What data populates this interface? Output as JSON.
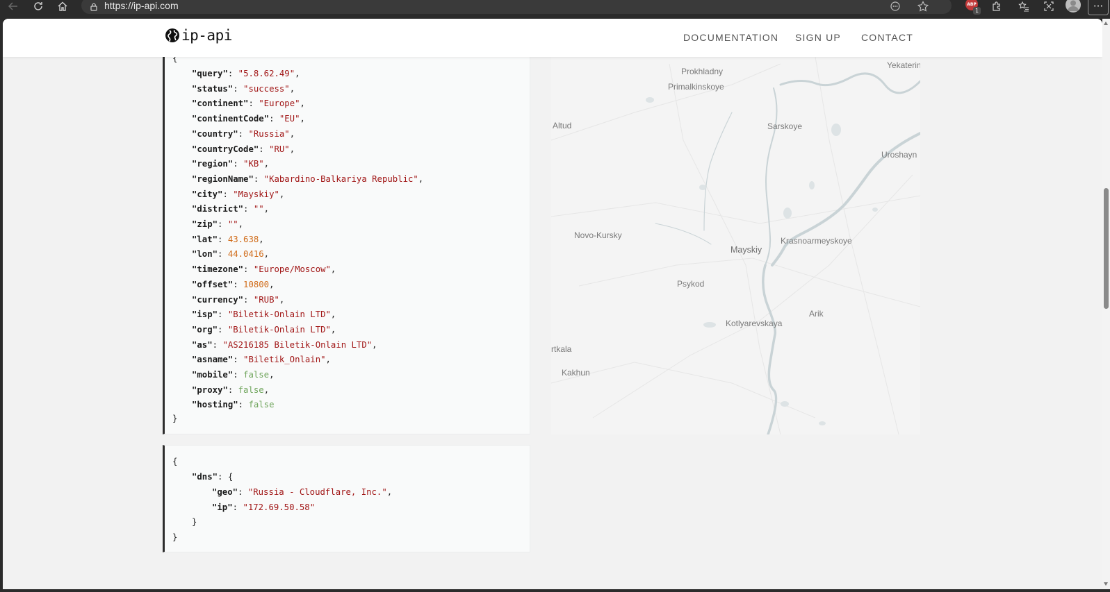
{
  "browser": {
    "url": "https://ip-api.com",
    "extension_badge_text": "ABP",
    "extension_badge_count": "1",
    "menu_label": "···"
  },
  "navbar": {
    "logo_text": "ip-api",
    "links": [
      "DOCUMENTATION",
      "SIGN UP",
      "CONTACT"
    ]
  },
  "response": [
    {
      "key": "query",
      "value": "5.8.62.49",
      "type": "string"
    },
    {
      "key": "status",
      "value": "success",
      "type": "string"
    },
    {
      "key": "continent",
      "value": "Europe",
      "type": "string"
    },
    {
      "key": "continentCode",
      "value": "EU",
      "type": "string"
    },
    {
      "key": "country",
      "value": "Russia",
      "type": "string"
    },
    {
      "key": "countryCode",
      "value": "RU",
      "type": "string"
    },
    {
      "key": "region",
      "value": "KB",
      "type": "string"
    },
    {
      "key": "regionName",
      "value": "Kabardino-Balkariya Republic",
      "type": "string"
    },
    {
      "key": "city",
      "value": "Mayskiy",
      "type": "string"
    },
    {
      "key": "district",
      "value": "",
      "type": "string"
    },
    {
      "key": "zip",
      "value": "",
      "type": "string"
    },
    {
      "key": "lat",
      "value": "43.638",
      "type": "number"
    },
    {
      "key": "lon",
      "value": "44.0416",
      "type": "number"
    },
    {
      "key": "timezone",
      "value": "Europe/Moscow",
      "type": "string"
    },
    {
      "key": "offset",
      "value": "10800",
      "type": "number"
    },
    {
      "key": "currency",
      "value": "RUB",
      "type": "string"
    },
    {
      "key": "isp",
      "value": "Biletik-Onlain LTD",
      "type": "string"
    },
    {
      "key": "org",
      "value": "Biletik-Onlain LTD",
      "type": "string"
    },
    {
      "key": "as",
      "value": "AS216185 Biletik-Onlain LTD",
      "type": "string"
    },
    {
      "key": "asname",
      "value": "Biletik_Onlain",
      "type": "string"
    },
    {
      "key": "mobile",
      "value": "false",
      "type": "boolean"
    },
    {
      "key": "proxy",
      "value": "false",
      "type": "boolean"
    },
    {
      "key": "hosting",
      "value": "false",
      "type": "boolean"
    }
  ],
  "dns": {
    "key": "dns",
    "fields": [
      {
        "key": "geo",
        "value": "Russia - Cloudflare, Inc.",
        "type": "string"
      },
      {
        "key": "ip",
        "value": "172.69.50.58",
        "type": "string"
      }
    ]
  },
  "map": {
    "labels": [
      "Prokhladny",
      "Primalkinskoye",
      "Yekaterin",
      "Altud",
      "Sarskoye",
      "Uroshayn",
      "Novo-Kursky",
      "Mayskiy",
      "Krasnoarmeyskoye",
      "Psykod",
      "Arik",
      "Kotlyarevskaya",
      "rtkala",
      "Kakhun"
    ]
  },
  "colors": {
    "json_key": "#1a1a1a",
    "json_string": "#a11616",
    "json_number": "#d06a17",
    "json_boolean": "#6ea45a",
    "panel_border_accent": "#2d2d2d"
  }
}
